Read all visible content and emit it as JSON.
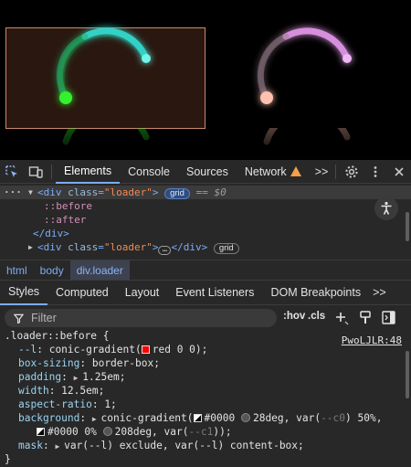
{
  "devtools": {
    "tabs": [
      "Elements",
      "Console",
      "Sources",
      "Network"
    ],
    "more_tabs": ">>"
  },
  "tree": {
    "div_open": "div",
    "class_attr": "class",
    "class_val": "\"loader\"",
    "grid_badge": "grid",
    "eq_dollar": "== $0",
    "before": "::before",
    "after": "::after",
    "close_div": "</div>",
    "ell": "…"
  },
  "breadcrumb": [
    "html",
    "body",
    "div.loader"
  ],
  "subtabs": [
    "Styles",
    "Computed",
    "Layout",
    "Event Listeners",
    "DOM Breakpoints"
  ],
  "filter": {
    "placeholder": "Filter",
    "hov": ":hov",
    "cls": ".cls"
  },
  "rule": {
    "selector": ".loader::before {",
    "source": "PwoLJLR:48",
    "p_l": "--l",
    "v_l_a": "conic-gradient(",
    "v_l_b": "red 0 0);",
    "p_bs": "box-sizing",
    "v_bs": "border-box;",
    "p_pad": "padding",
    "v_pad": "1.25em;",
    "p_w": "width",
    "v_w": "12.5em;",
    "p_ar": "aspect-ratio",
    "v_ar": "1;",
    "p_bg": "background",
    "v_bg_a": "conic-gradient(",
    "v_bg_b": "#0000",
    "v_bg_c": "28deg, var(",
    "v_bg_d": "--c0",
    "v_bg_e": ") 50%,",
    "v_bg_f": "#0000 0%",
    "v_bg_g": "208deg, var(",
    "v_bg_h": "--c1",
    "v_bg_i": "));",
    "p_mask": "mask",
    "v_mask": "var(--l) exclude, var(--l) content-box;",
    "close": "}"
  },
  "colors": {
    "accent": "#7cacf8",
    "swatch_red": "#ff0000"
  }
}
